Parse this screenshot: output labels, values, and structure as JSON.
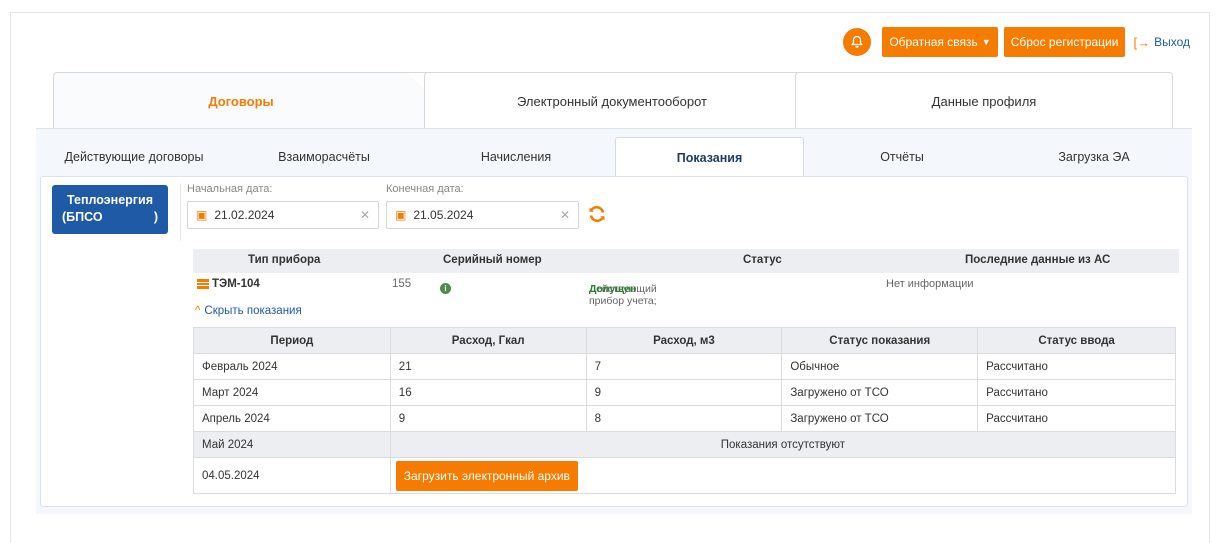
{
  "header": {
    "feedback_label": "Обратная связь",
    "reset_label": "Сброс регистрации",
    "logout_label": "Выход"
  },
  "main_tabs": [
    {
      "label": "Договоры",
      "active": true
    },
    {
      "label": "Электронный документооборот",
      "active": false
    },
    {
      "label": "Данные профиля",
      "active": false
    }
  ],
  "sub_tabs": [
    {
      "label": "Действующие договоры",
      "active": false
    },
    {
      "label": "Взаиморасчёты",
      "active": false
    },
    {
      "label": "Начисления",
      "active": false
    },
    {
      "label": "Показания",
      "active": true
    },
    {
      "label": "Отчёты",
      "active": false
    },
    {
      "label": "Загрузка ЭА",
      "active": false
    }
  ],
  "org": {
    "line1": "Теплоэнергия",
    "line2_a": "(БПСО",
    "line2_b": ")"
  },
  "filters": {
    "start_label": "Начальная дата:",
    "start_value": "21.02.2024",
    "end_label": "Конечная дата:",
    "end_value": "21.05.2024"
  },
  "devices": {
    "headers": [
      "Тип прибора",
      "Серийный номер",
      "Статус",
      "Последние данные из АС"
    ],
    "row": {
      "type": "ТЭМ-104",
      "serial": "155",
      "status_prefix": "Действующий прибор учета;",
      "status_value": "Допущен",
      "last_data": "Нет информации"
    }
  },
  "hide_readings_label": "Скрыть показания",
  "readings": {
    "headers": [
      "Период",
      "Расход, Гкал",
      "Расход, м3",
      "Статус показания",
      "Статус ввода"
    ],
    "rows": [
      [
        "Февраль 2024",
        "21",
        "7",
        "Обычное",
        "Рассчитано"
      ],
      [
        "Март 2024",
        "16",
        "9",
        "Загружено от ТСО",
        "Рассчитано"
      ],
      [
        "Апрель 2024",
        "9",
        "8",
        "Загружено от ТСО",
        "Рассчитано"
      ]
    ],
    "may_period": "Май 2024",
    "may_message": "Показания отсутствуют",
    "last_date": "04.05.2024",
    "upload_label": "Загрузить электронный архив"
  },
  "colors": {
    "accent": "#f57c00",
    "primary": "#1f5aa6",
    "ok": "#2e7d32"
  }
}
